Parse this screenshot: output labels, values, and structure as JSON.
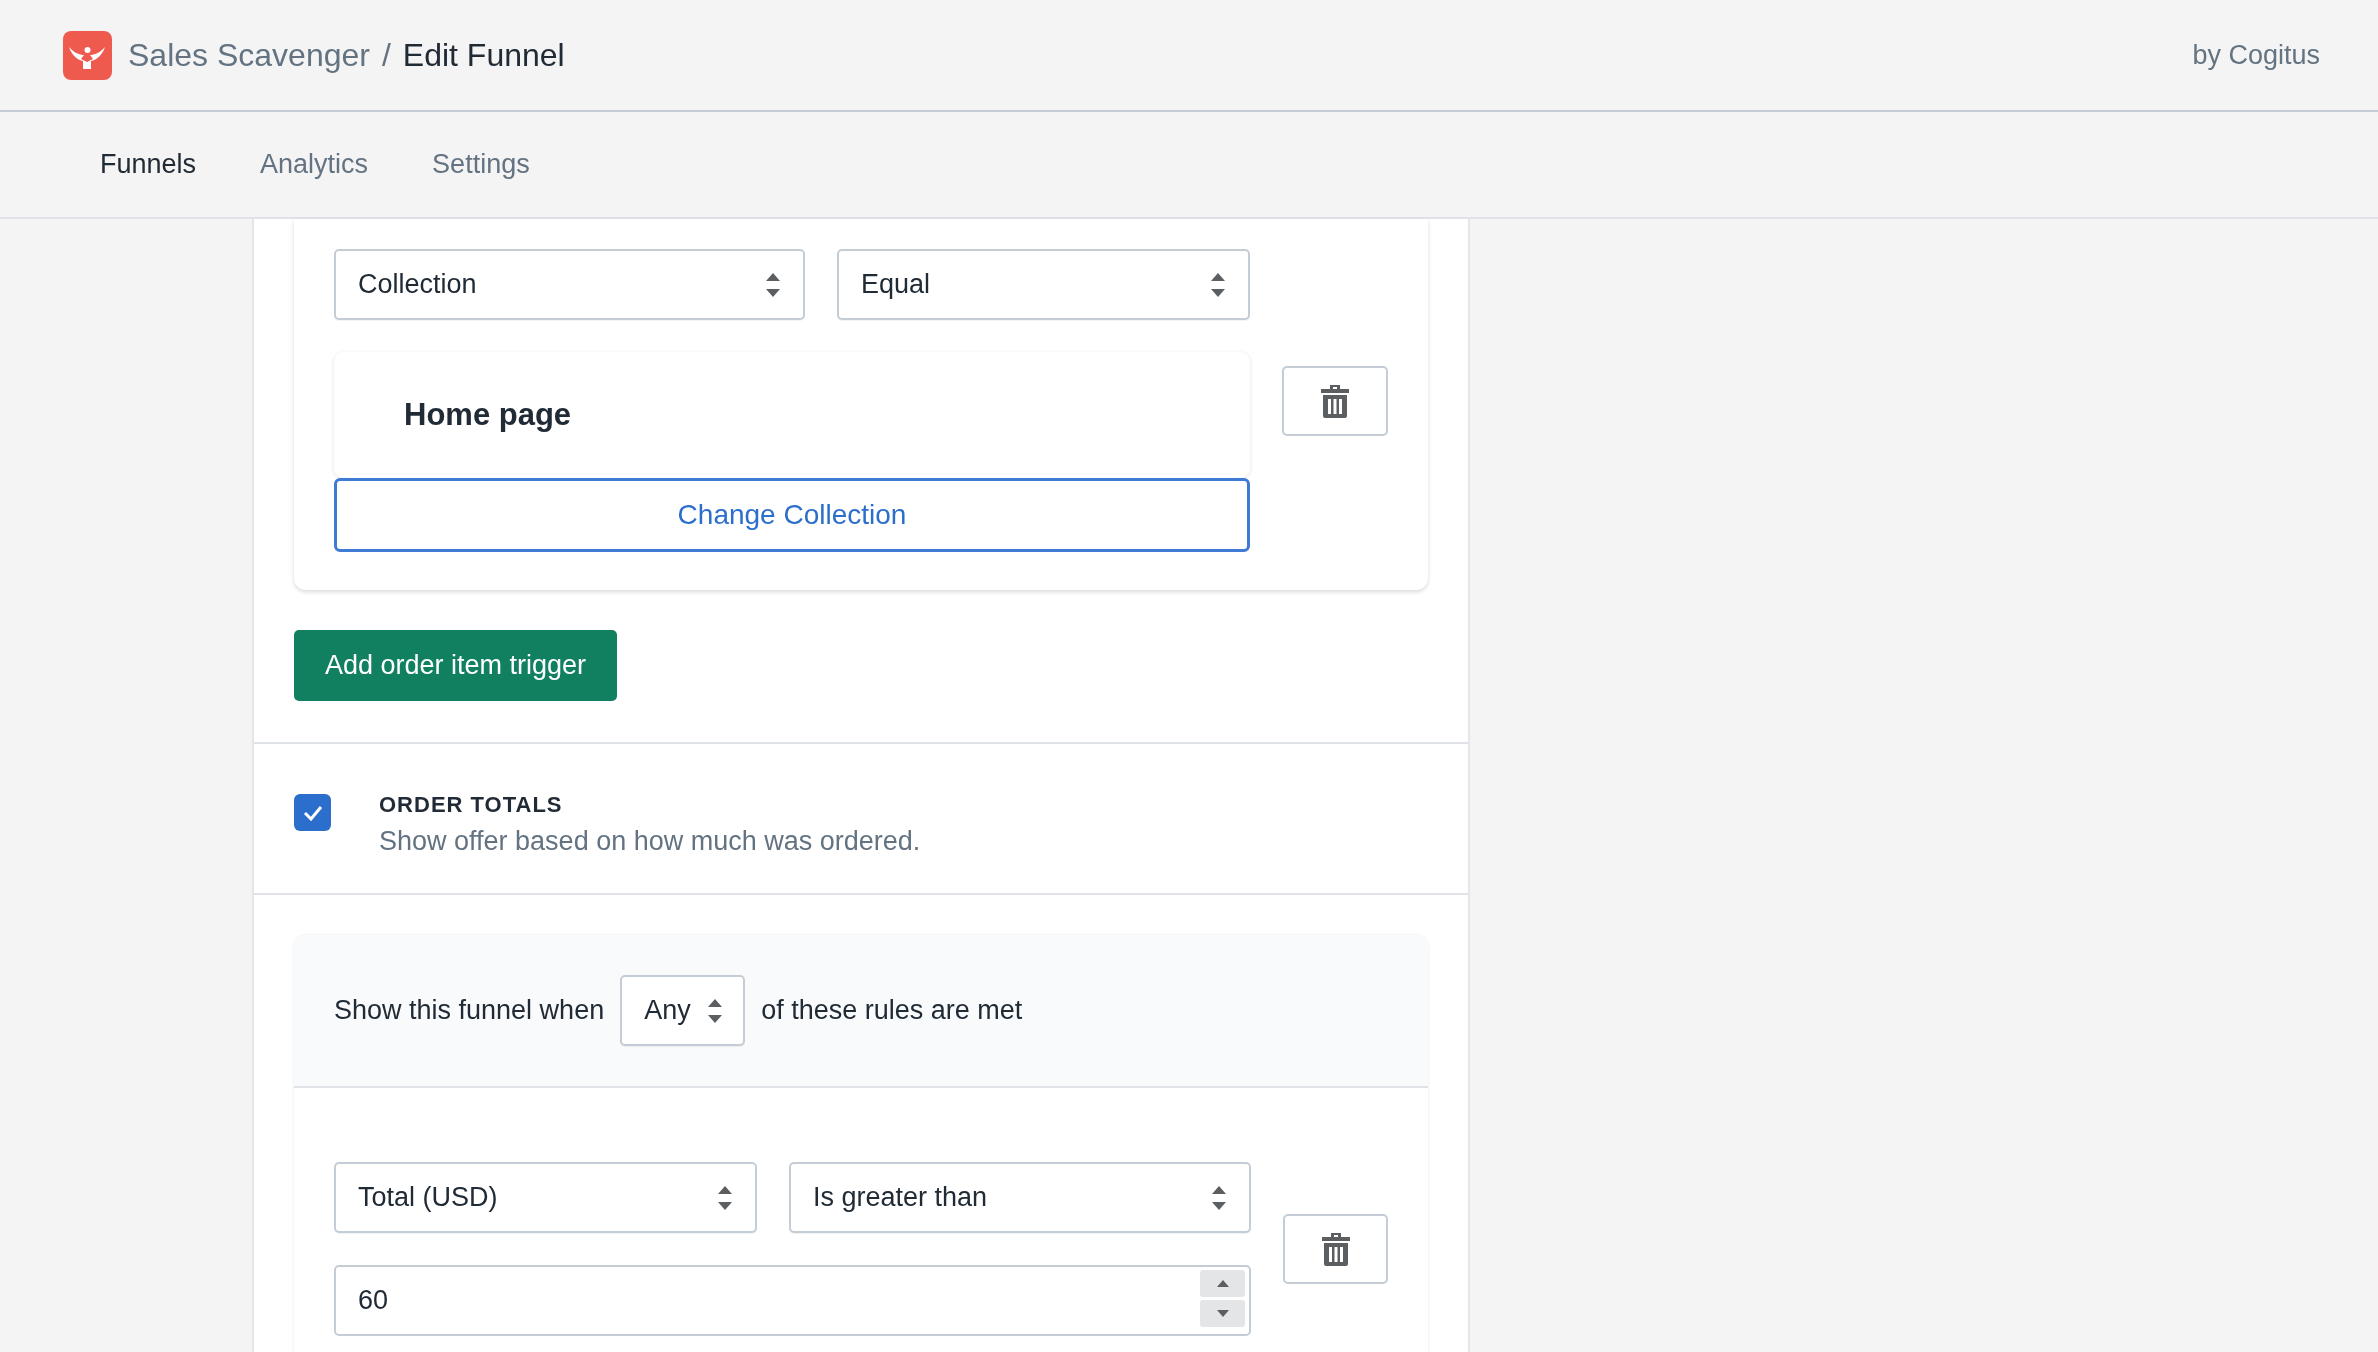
{
  "header": {
    "app_name": "Sales Scavenger",
    "separator": "/",
    "page_title": "Edit Funnel",
    "byline": "by Cogitus"
  },
  "tabs": [
    {
      "label": "Funnels",
      "selected": true
    },
    {
      "label": "Analytics",
      "selected": false
    },
    {
      "label": "Settings",
      "selected": false
    }
  ],
  "trigger_card": {
    "selects": [
      {
        "value": "Collection"
      },
      {
        "value": "Equal"
      }
    ],
    "item_title": "Home page",
    "change_button": "Change Collection"
  },
  "add_button": "Add order item trigger",
  "order_totals": {
    "checked": true,
    "title": "ORDER TOTALS",
    "description": "Show offer based on how much was ordered."
  },
  "rules": {
    "prefix": "Show this funnel when",
    "match": "Any",
    "suffix": "of these rules are met",
    "rule": {
      "selects": [
        {
          "value": "Total (USD)"
        },
        {
          "value": "Is greater than"
        }
      ],
      "value": "60"
    }
  }
}
